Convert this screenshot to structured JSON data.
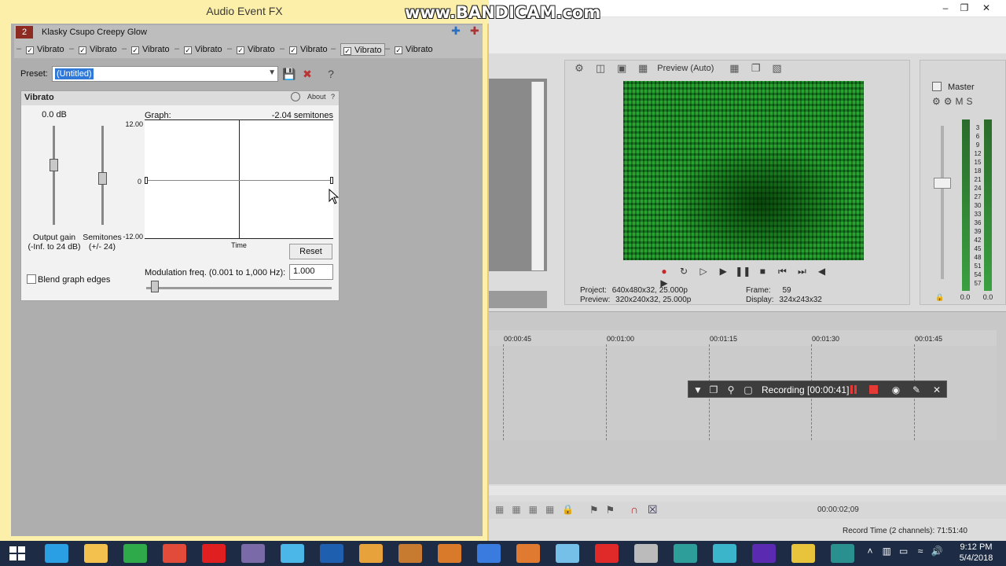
{
  "window": {
    "title": "Audio Event FX"
  },
  "watermark": "www.BANDICAM.com",
  "fx_chain": {
    "track_number": "2",
    "track_name": "Klasky Csupo Creepy Glow",
    "plugins": [
      {
        "label": "Vibrato",
        "checked": true,
        "active": false
      },
      {
        "label": "Vibrato",
        "checked": true,
        "active": false
      },
      {
        "label": "Vibrato",
        "checked": true,
        "active": false
      },
      {
        "label": "Vibrato",
        "checked": true,
        "active": false
      },
      {
        "label": "Vibrato",
        "checked": true,
        "active": false
      },
      {
        "label": "Vibrato",
        "checked": true,
        "active": false
      },
      {
        "label": "Vibrato",
        "checked": true,
        "active": true
      },
      {
        "label": "Vibrato",
        "checked": true,
        "active": false
      }
    ]
  },
  "preset": {
    "label": "Preset:",
    "value": "(Untitled)"
  },
  "vibrato": {
    "title": "Vibrato",
    "about_label": "About",
    "help_label": "?",
    "output_gain_value": "0.0 dB",
    "output_gain_label": "Output gain",
    "output_gain_range": "(-Inf. to 24 dB)",
    "output_gain_level": 0.6,
    "semitones_label": "Semitones",
    "semitones_range": "(+/- 24)",
    "semitones_level": 0.47,
    "graph_label": "Graph:",
    "graph_semitones": "-2.04 semitones",
    "graph_ymax": "12.00",
    "graph_yzero": "0",
    "graph_ymin": "-12.00",
    "graph_xlabel": "Time",
    "reset_label": "Reset",
    "blend_label": "Blend graph edges",
    "blend_checked": false,
    "mod_label": "Modulation freq. (0.001 to 1,000 Hz):",
    "mod_value": "1.000"
  },
  "preview": {
    "mode": "Preview (Auto)",
    "project_label": "Project:",
    "project_value": "640x480x32, 25.000p",
    "preview_label": "Preview:",
    "preview_value": "320x240x32, 25.000p",
    "frame_label": "Frame:",
    "frame_value": "59",
    "display_label": "Display:",
    "display_value": "324x243x32"
  },
  "master": {
    "label": "Master",
    "ticks": [
      "3",
      "6",
      "9",
      "12",
      "15",
      "18",
      "21",
      "24",
      "27",
      "30",
      "33",
      "36",
      "39",
      "42",
      "45",
      "48",
      "51",
      "54",
      "57"
    ],
    "foot_left": "0.0",
    "foot_right": "0.0"
  },
  "timeline": {
    "marks": [
      "00:00:45",
      "00:01:00",
      "00:01:15",
      "00:01:30",
      "00:01:45"
    ],
    "timecode": "00:00:02;09",
    "record_time": "Record Time (2 channels): 71:51:40"
  },
  "recording": {
    "text": "Recording [00:00:41]"
  },
  "clock": {
    "time": "9:12 PM",
    "date": "5/4/2018"
  },
  "colors": {
    "fx_titlebar": "#fcefaa",
    "record_red": "#e53935",
    "taskbar": "#1d2c44",
    "preset_highlight": "#3078d8"
  }
}
